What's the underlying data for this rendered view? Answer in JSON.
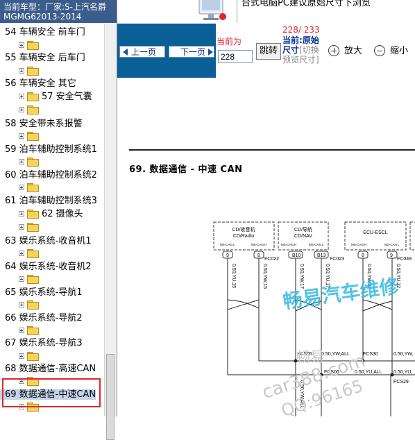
{
  "vehicle": {
    "label": "当前车型：",
    "value": "厂家:S-上汽名爵MGMG62013-2014"
  },
  "banner": {
    "text": "台式电脑PC建议原始尺寸下浏览"
  },
  "tree": {
    "items": [
      {
        "text": "54 车辆安全 前车门"
      },
      {
        "text": "55 车辆安全 后车门"
      },
      {
        "text": "56 车辆安全 其它"
      },
      {
        "text": "57 安全气囊"
      },
      {
        "text": "58 安全带未系报警"
      },
      {
        "text": "59 泊车辅助控制系统1"
      },
      {
        "text": "60 泊车辅助控制系统2"
      },
      {
        "text": "61 泊车辅助控制系统3"
      },
      {
        "text": "62 摄像头"
      },
      {
        "text": "63 娱乐系统-收音机1"
      },
      {
        "text": "64 娱乐系统-收音机2"
      },
      {
        "text": "65 娱乐系统-导航1"
      },
      {
        "text": "66 娱乐系统-导航2"
      },
      {
        "text": "67 娱乐系统-导航3"
      },
      {
        "text": "68 数据通信-高速CAN"
      },
      {
        "text": "69 数据通信-中速CAN"
      }
    ]
  },
  "toolbar": {
    "prev_label": "上一页",
    "next_label": "下一页",
    "current_label": "当前为",
    "page_value": "228",
    "jump_label": "跳转",
    "page_count": "228/ 233",
    "mode_current": "当前:",
    "mode_name": "原始尺寸",
    "mode_switch": "[切换预览尺寸]",
    "zoom_in_label": "放大",
    "zoom_out_label": "缩小"
  },
  "document": {
    "title": "69. 数据通信 - 中速 CAN",
    "modules": [
      {
        "line1": "CD/收音机",
        "line2": "CD/Radio",
        "pin_a": "MS-CAN L",
        "pin_b": "MS-CAN H"
      },
      {
        "line1": "CD/导航",
        "line2": "CD/NAV",
        "pin_a": "MS-CAN H",
        "pin_b": "MS-CAN L"
      },
      {
        "line1": "ECU-ESCL",
        "line2": "",
        "pin_a": "MS-CAN H",
        "pin_b": "MS-CAN L"
      }
    ],
    "pins": [
      "9",
      "8",
      "B10",
      "B13",
      "8",
      "9"
    ],
    "connectors": [
      "FC022",
      "FC023",
      "FC049"
    ],
    "wires": [
      "0.50,YU,15",
      "0.50,YW,15",
      "0.50,YW,17",
      "0.50,YU,17",
      "0.50,YW,32",
      "0.50,YU,32",
      "0.50,YW,ALL"
    ],
    "splices": [
      {
        "name": "FCS05",
        "wire": "0.50,YW,ALL"
      },
      {
        "name": "FCS30",
        "wire": "0.50,YW,"
      },
      {
        "name": "FCS06",
        "wire": "0.50,YU,ALL"
      },
      {
        "name": "FCS29",
        "wire": "0.50,YU,"
      }
    ]
  },
  "watermarks": {
    "main": "畅易汽车维修",
    "sub1": "畅易",
    "sub2": "car388.com",
    "sub3": "QQ:96165"
  },
  "colors": {
    "header_bg": "#3c5d8c",
    "nav_bg": "#0a5f97",
    "selection_border": "#e0262a",
    "watermark": "#37b8e1"
  }
}
